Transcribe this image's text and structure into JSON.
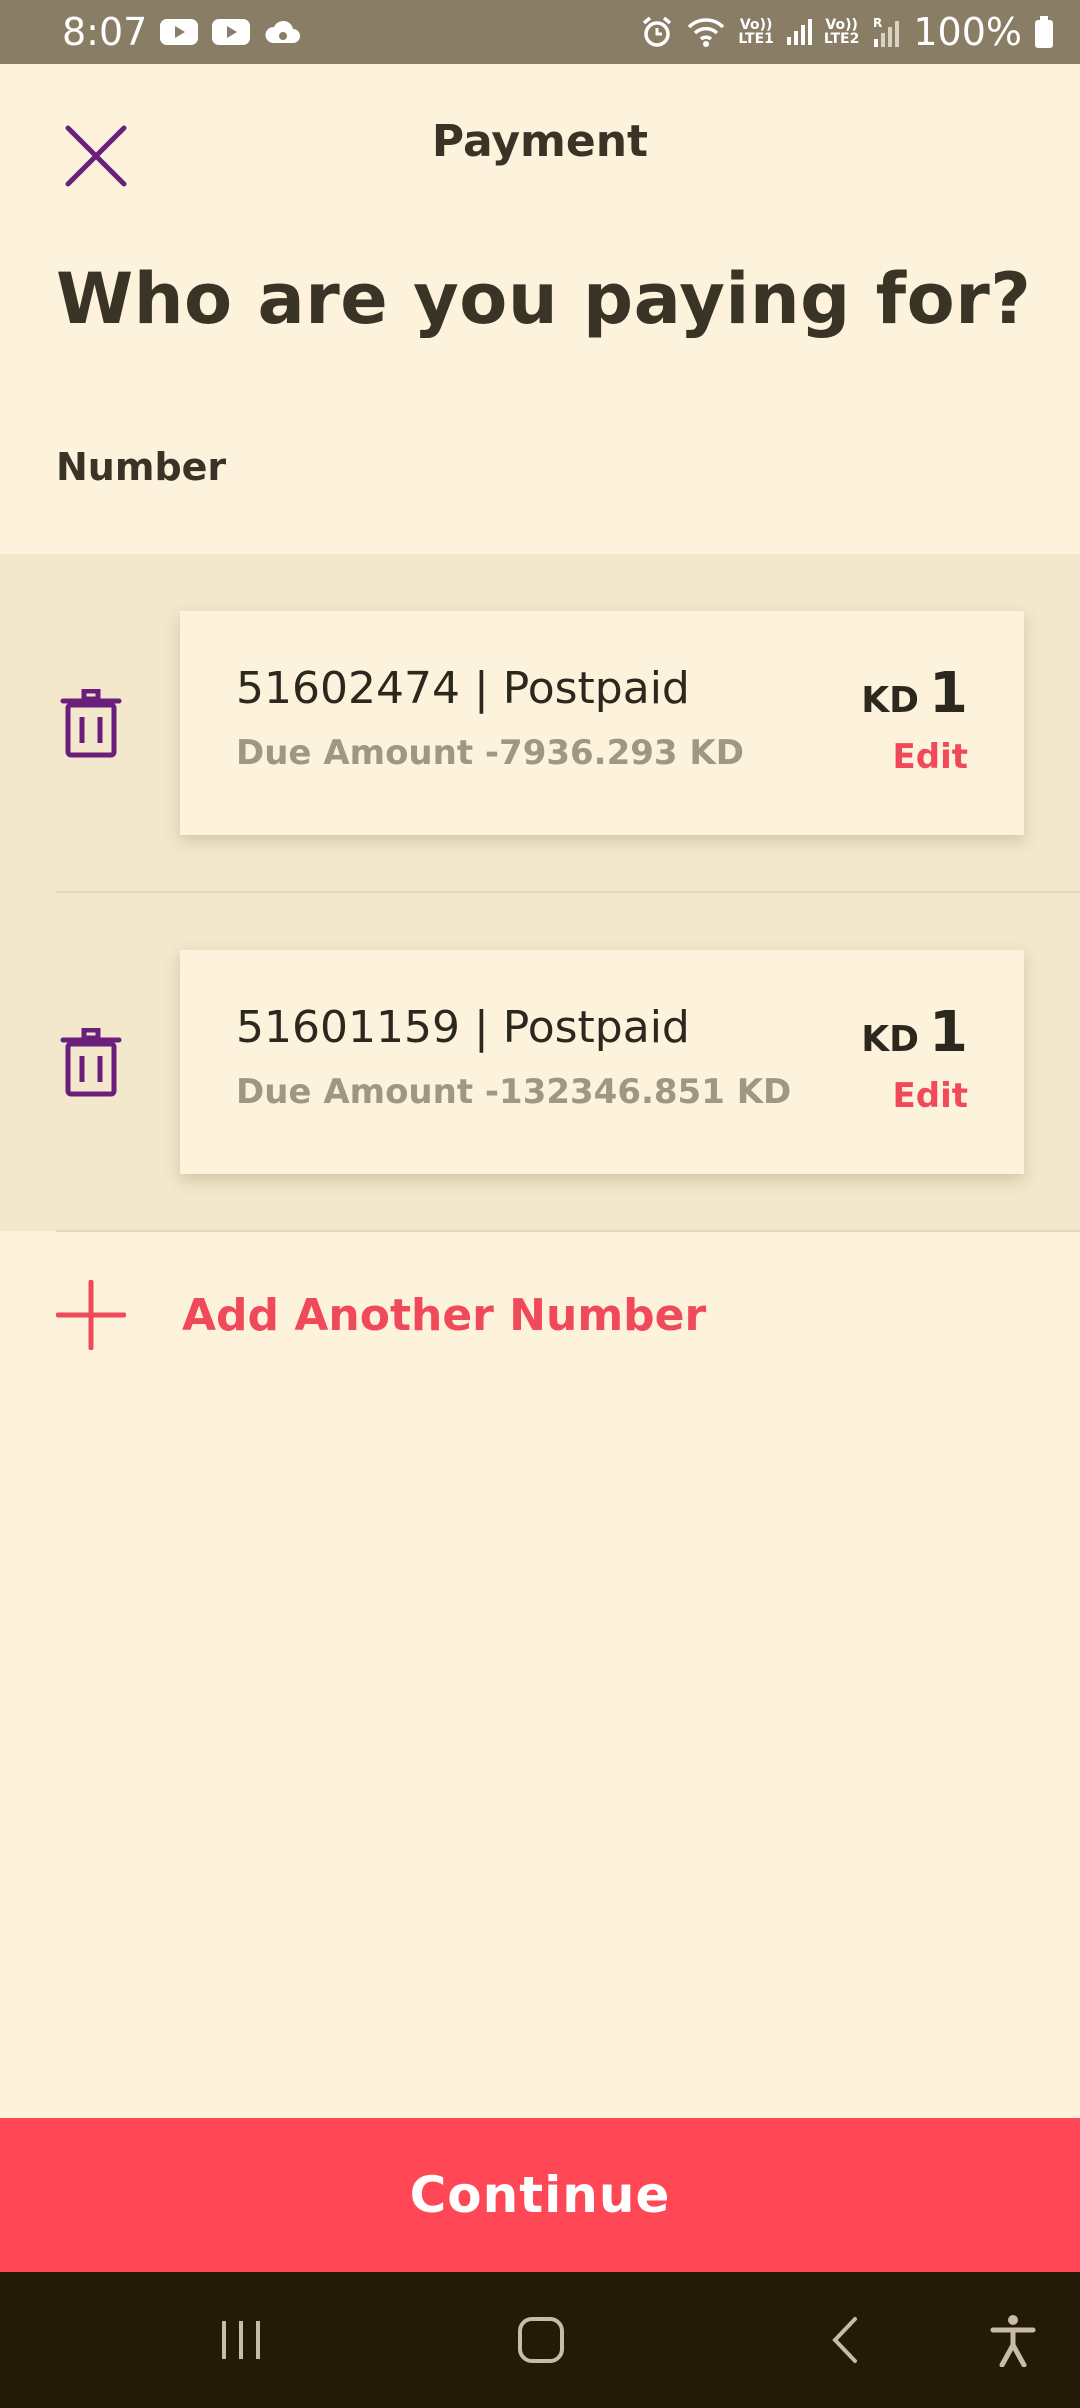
{
  "status_bar": {
    "time": "8:07",
    "battery": "100%",
    "lte1": "LTE1",
    "lte2": "LTE2",
    "volte": "Vo))",
    "roaming": "R"
  },
  "header": {
    "title": "Payment",
    "close_icon": "close-icon"
  },
  "headline": "Who are you paying for?",
  "section_label": "Number",
  "numbers": [
    {
      "title": "51602474 | Postpaid",
      "due": "Due Amount -7936.293 KD",
      "currency": "KD",
      "amount": "1",
      "edit_label": "Edit"
    },
    {
      "title": "51601159 | Postpaid",
      "due": "Due Amount -132346.851 KD",
      "currency": "KD",
      "amount": "1",
      "edit_label": "Edit"
    }
  ],
  "add_number_label": "Add Another Number",
  "continue_label": "Continue",
  "colors": {
    "background": "#fdf3dd",
    "accent": "#ff4755",
    "icon_purple": "#6a1f7a",
    "status_bar": "#8a7d66",
    "nav_bar": "#241a08"
  }
}
